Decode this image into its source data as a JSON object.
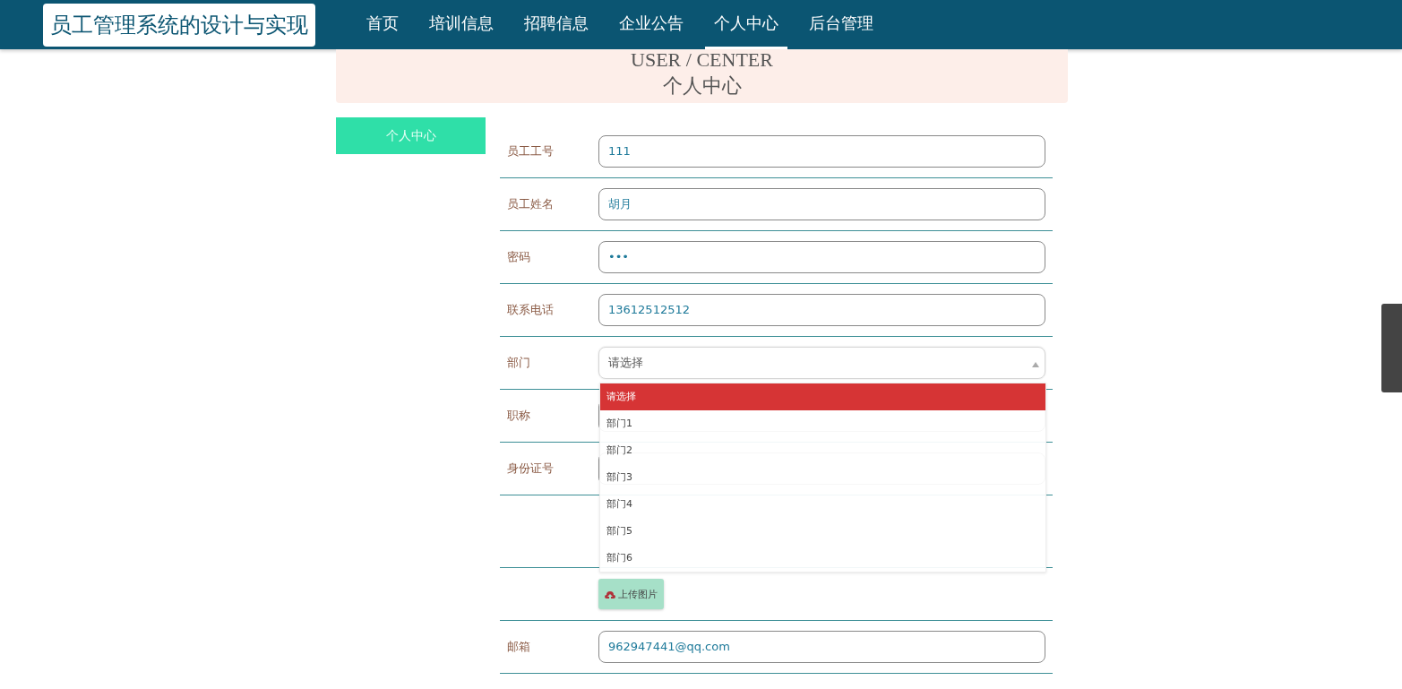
{
  "header": {
    "logo": "员工管理系统的设计与实现",
    "nav": [
      {
        "label": "首页",
        "selected": false
      },
      {
        "label": "培训信息",
        "selected": false
      },
      {
        "label": "招聘信息",
        "selected": false
      },
      {
        "label": "企业公告",
        "selected": false
      },
      {
        "label": "个人中心",
        "selected": true
      },
      {
        "label": "后台管理",
        "selected": false
      }
    ]
  },
  "banner": {
    "title": "USER / CENTER",
    "subtitle": "个人中心"
  },
  "sidebar": {
    "items": [
      {
        "label": "个人中心",
        "selected": true
      }
    ]
  },
  "form": {
    "rows": [
      {
        "kind": "input",
        "label": "员工工号",
        "value": "111"
      },
      {
        "kind": "input",
        "label": "员工姓名",
        "value": "胡月"
      },
      {
        "kind": "input",
        "label": "密码",
        "value": "•••"
      },
      {
        "kind": "input",
        "label": "联系电话",
        "value": "13612512512"
      },
      {
        "kind": "select",
        "label": "部门",
        "value": "请选择",
        "expanded": true,
        "options": [
          {
            "label": "请选择",
            "selected": true
          },
          {
            "label": "部门1",
            "selected": false
          },
          {
            "label": "部门2",
            "selected": false
          },
          {
            "label": "部门3",
            "selected": false
          },
          {
            "label": "部门4",
            "selected": false
          },
          {
            "label": "部门5",
            "selected": false
          },
          {
            "label": "部门6",
            "selected": false
          }
        ]
      },
      {
        "kind": "input",
        "label": "职称"
      },
      {
        "kind": "input",
        "label": "身份证号"
      },
      {
        "kind": "image"
      },
      {
        "kind": "upload",
        "button": "上传图片"
      },
      {
        "kind": "input",
        "label": "邮箱",
        "value": "962947441@qq.com"
      }
    ]
  }
}
